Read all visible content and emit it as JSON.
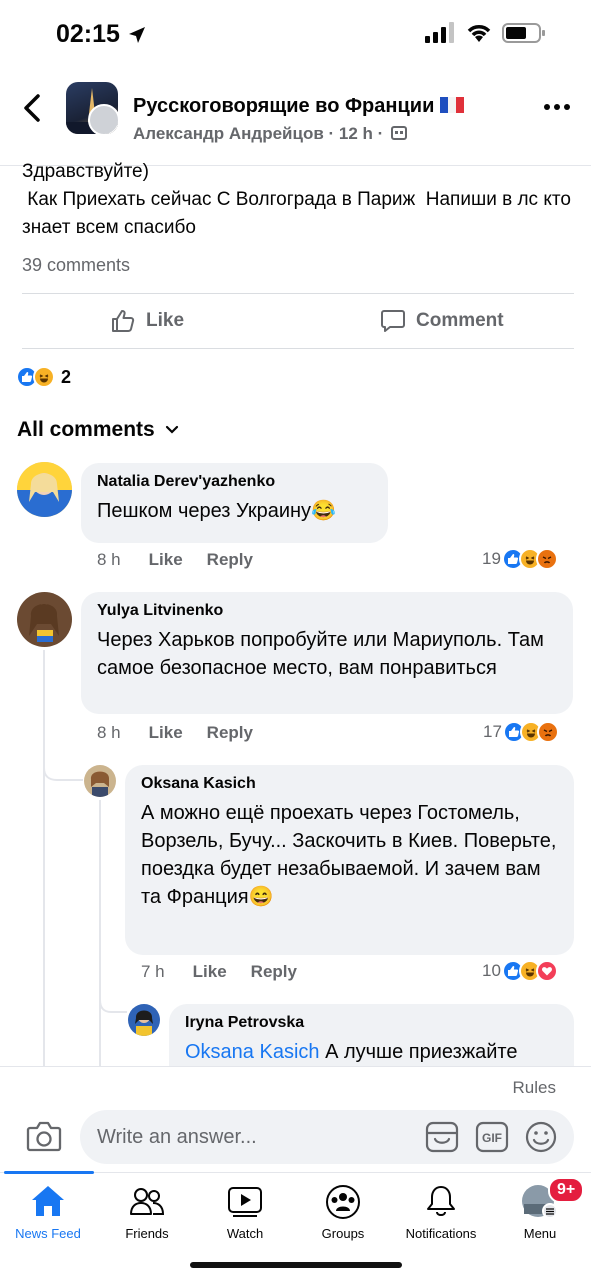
{
  "status_bar": {
    "time": "02:15"
  },
  "header": {
    "group_name": "Русскоговорящие во Франции",
    "post_meta": "Александр Андрейцов · 12 h ·"
  },
  "post": {
    "line1": "Здравствуйте)",
    "line2": " Как Приехать сейчас С Волгограда в Париж  Напиши в лс кто знает всем спасибо",
    "comments_count": "39 comments",
    "like_label": "Like",
    "comment_label": "Comment",
    "reaction_count": "2"
  },
  "all_comments_label": "All comments",
  "comments": [
    {
      "author": "Natalia Derev'yazhenko",
      "text": "Пешком через Украину😂",
      "time": "8 h",
      "like": "Like",
      "reply": "Reply",
      "reactions": "19"
    },
    {
      "author": "Yulya Litvinenko",
      "text": "Через Харьков попробуйте или Мариуполь. Там самое безопасное место, вам понравиться",
      "time": "8 h",
      "like": "Like",
      "reply": "Reply",
      "reactions": "17"
    },
    {
      "author": "Oksana Kasich",
      "text": "А можно ещё проехать через Гостомель, Ворзель, Бучу... Заскочить в Киев. Поверьте, поездка будет незабываемой. И зачем вам та Франция😄",
      "time": "7 h",
      "like": "Like",
      "reply": "Reply",
      "reactions": "10"
    },
    {
      "author": "Iryna Petrovska",
      "mention": "Oksana Kasich",
      "text": " А лучше приезжайте"
    }
  ],
  "composer": {
    "rules": "Rules",
    "placeholder": "Write an answer..."
  },
  "tabs": [
    {
      "label": "News Feed"
    },
    {
      "label": "Friends"
    },
    {
      "label": "Watch"
    },
    {
      "label": "Groups"
    },
    {
      "label": "Notifications"
    },
    {
      "label": "Menu"
    }
  ],
  "menu_badge": "9+",
  "colors": {
    "accent": "#1877f2",
    "bubble": "#f0f2f5",
    "secondary_text": "#65676b",
    "badge": "#e41e3f"
  }
}
